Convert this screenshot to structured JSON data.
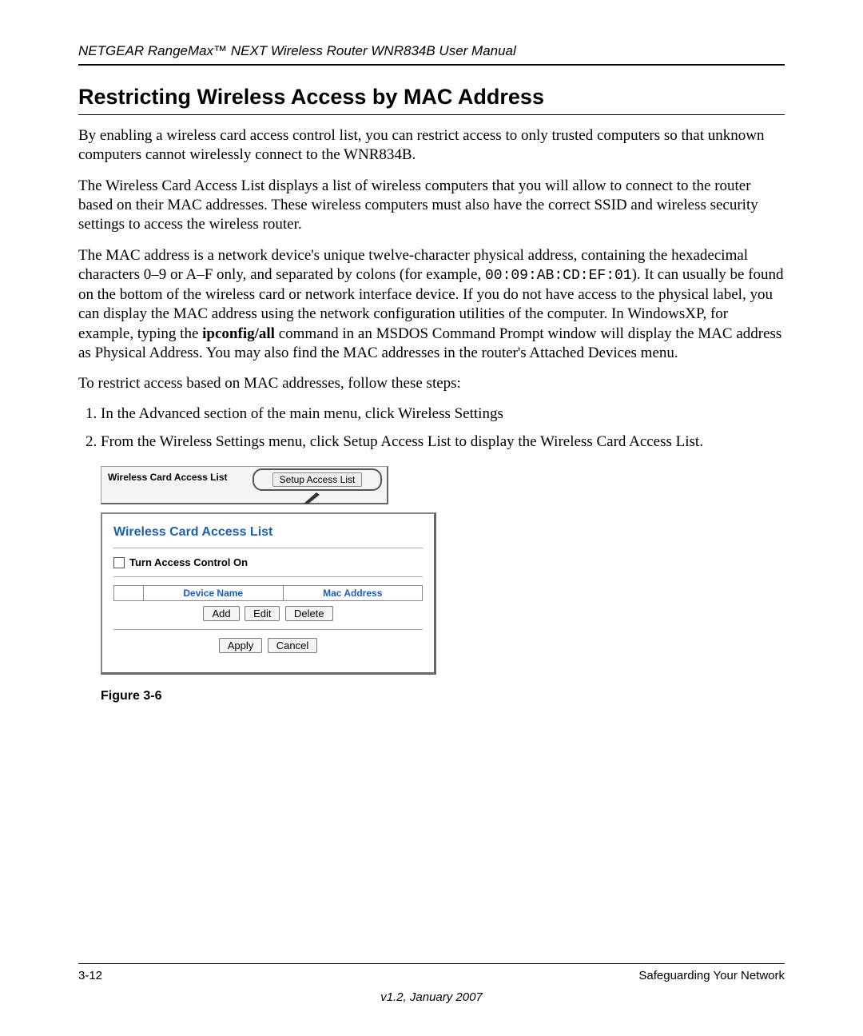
{
  "header": {
    "running": "NETGEAR RangeMax™ NEXT Wireless Router WNR834B User Manual"
  },
  "title": "Restricting Wireless Access by MAC Address",
  "paragraphs": {
    "p1": "By enabling a wireless card access control list, you can restrict access to only trusted computers so that unknown computers cannot wirelessly connect to the WNR834B.",
    "p2": "The Wireless Card Access List displays a list of wireless computers that you will allow to connect to the router based on their MAC addresses. These wireless computers must also have the correct SSID and wireless security settings to access the wireless router.",
    "p3a": "The MAC address is a network device's unique twelve-character physical address, containing the hexadecimal characters 0–9 or A–F only, and separated by colons (for example, ",
    "p3_mac": "00:09:AB:CD:EF:01",
    "p3b": "). It can usually be found on the bottom of the wireless card or network interface device. If you do not have access to the physical label, you can display the MAC address using the network configuration utilities of the computer. In WindowsXP, for example, typing the ",
    "p3_cmd": "ipconfig/all",
    "p3c": " command in an MSDOS Command Prompt window will display the MAC address as Physical Address. You may also find the MAC addresses in the router's Attached Devices menu.",
    "p4": "To restrict access based on MAC addresses, follow these steps:"
  },
  "steps": {
    "s1": "In the Advanced section of the main menu, click Wireless Settings",
    "s2": "From the Wireless Settings menu, click Setup Access List to display the Wireless Card Access List."
  },
  "figure": {
    "top_label": "Wireless Card Access List",
    "setup_btn": "Setup Access List",
    "panel_title": "Wireless Card Access List",
    "checkbox_label": "Turn Access Control On",
    "col_device": "Device Name",
    "col_mac": "Mac Address",
    "btn_add": "Add",
    "btn_edit": "Edit",
    "btn_delete": "Delete",
    "btn_apply": "Apply",
    "btn_cancel": "Cancel",
    "caption": "Figure 3-6"
  },
  "footer": {
    "page": "3-12",
    "section": "Safeguarding Your Network",
    "version": "v1.2, January 2007"
  }
}
